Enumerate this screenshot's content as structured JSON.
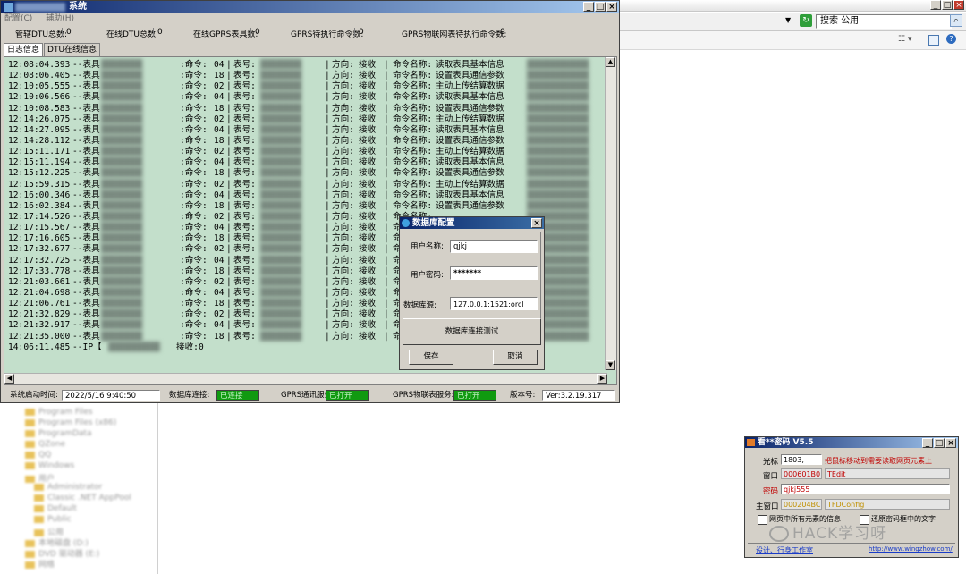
{
  "explorer": {
    "search_text": "搜索 公用",
    "tree_items": [
      "Program Files",
      "Program Files (x86)",
      "ProgramData",
      "QZone",
      "QQ",
      "Windows",
      "用户",
      "Administrator",
      "Classic .NET AppPool",
      "Default",
      "Public",
      "公用",
      "本地磁盘 (D:)",
      "DVD 驱动器 (E:)",
      "网络"
    ]
  },
  "main_window": {
    "title": "系统",
    "menu": [
      "配置(C)",
      "辅助(H)"
    ],
    "stats": [
      {
        "label": "管辖DTU总数:",
        "value": "0"
      },
      {
        "label": "在线DTU总数:",
        "value": "0"
      },
      {
        "label": "在线GPRS表具数:",
        "value": "0"
      },
      {
        "label": "GPRS待执行命令数:",
        "value": "0"
      },
      {
        "label": "GPRS物联网表待执行命令数:",
        "value": "0"
      }
    ],
    "tabs": [
      "日志信息",
      "DTU在线信息"
    ],
    "log_lines": [
      {
        "time": "12:08:04.393",
        "cmd": "04",
        "dir": "接收",
        "name": "读取表具基本信息"
      },
      {
        "time": "12:08:06.405",
        "cmd": "18",
        "dir": "接收",
        "name": "设置表具通信参数"
      },
      {
        "time": "12:10:05.555",
        "cmd": "02",
        "dir": "接收",
        "name": "主动上传结算数据"
      },
      {
        "time": "12:10:06.566",
        "cmd": "04",
        "dir": "接收",
        "name": "读取表具基本信息"
      },
      {
        "time": "12:10:08.583",
        "cmd": "18",
        "dir": "接收",
        "name": "设置表具通信参数"
      },
      {
        "time": "12:14:26.075",
        "cmd": "02",
        "dir": "接收",
        "name": "主动上传结算数据"
      },
      {
        "time": "12:14:27.095",
        "cmd": "04",
        "dir": "接收",
        "name": "读取表具基本信息"
      },
      {
        "time": "12:14:28.112",
        "cmd": "18",
        "dir": "接收",
        "name": "设置表具通信参数"
      },
      {
        "time": "12:15:11.171",
        "cmd": "02",
        "dir": "接收",
        "name": "主动上传结算数据"
      },
      {
        "time": "12:15:11.194",
        "cmd": "04",
        "dir": "接收",
        "name": "读取表具基本信息"
      },
      {
        "time": "12:15:12.225",
        "cmd": "18",
        "dir": "接收",
        "name": "设置表具通信参数"
      },
      {
        "time": "12:15:59.315",
        "cmd": "02",
        "dir": "接收",
        "name": "主动上传结算数据"
      },
      {
        "time": "12:16:00.346",
        "cmd": "04",
        "dir": "接收",
        "name": "读取表具基本信息"
      },
      {
        "time": "12:16:02.384",
        "cmd": "18",
        "dir": "接收",
        "name": "设置表具通信参数"
      },
      {
        "time": "12:17:14.526",
        "cmd": "02",
        "dir": "接收",
        "name": ""
      },
      {
        "time": "12:17:15.567",
        "cmd": "04",
        "dir": "接收",
        "name": ""
      },
      {
        "time": "12:17:16.605",
        "cmd": "18",
        "dir": "接收",
        "name": ""
      },
      {
        "time": "12:17:32.677",
        "cmd": "02",
        "dir": "接收",
        "name": ""
      },
      {
        "time": "12:17:32.725",
        "cmd": "04",
        "dir": "接收",
        "name": ""
      },
      {
        "time": "12:17:33.778",
        "cmd": "18",
        "dir": "接收",
        "name": ""
      },
      {
        "time": "12:21:03.661",
        "cmd": "02",
        "dir": "接收",
        "name": ""
      },
      {
        "time": "12:21:04.698",
        "cmd": "04",
        "dir": "接收",
        "name": ""
      },
      {
        "time": "12:21:06.761",
        "cmd": "18",
        "dir": "接收",
        "name": ""
      },
      {
        "time": "12:21:32.829",
        "cmd": "02",
        "dir": "接收",
        "name": ""
      },
      {
        "time": "12:21:32.917",
        "cmd": "04",
        "dir": "接收",
        "name": ""
      },
      {
        "time": "12:21:35.000",
        "cmd": "18",
        "dir": "接收",
        "name": ""
      }
    ],
    "log_labels": {
      "meter_prefix": "--表具",
      "cmd_label": ":命令:",
      "meter_no": "表号:",
      "dir_label": "方向:",
      "name_label": "命令名称:"
    },
    "last_line": {
      "time": "14:06:11.485",
      "text": "--IP【",
      "tail": "接收:0"
    },
    "status": {
      "start_label": "系统启动时间:",
      "start_value": "2022/5/16 9:40:50",
      "db_label": "数据库连接:",
      "db_value": "已连接",
      "gprs_label": "GPRS通讯服务:",
      "gprs_value": "已打开",
      "iot_label": "GPRS物联表服务:",
      "iot_value": "已打开",
      "ver_label": "版本号:",
      "ver_value": "Ver:3.2.19.317"
    },
    "colors": {
      "log_bg": "#c3dfcb",
      "status_green": "#109a10",
      "titlebar": "#0a246a"
    }
  },
  "db_dialog": {
    "title": "数据库配置",
    "user_label": "用户名称:",
    "user_value": "qjkj",
    "pwd_label": "用户密码:",
    "pwd_value": "*******",
    "db_label": "数据库源:",
    "db_value": "127.0.0.1:1521:orcl",
    "test_button": "数据库连接测试",
    "save_button": "保存",
    "cancel_button": "取消"
  },
  "tool_window": {
    "title": "看**密码 V5.5",
    "cursor_label": "光标",
    "cursor_value": "1803, 1469",
    "cursor_hint": "把鼠标移动到需要读取网页元素上",
    "window_label": "窗口",
    "window_handle": "000601B0",
    "window_class": "TEdit",
    "pwd_label": "密码",
    "pwd_value": "qjkj555",
    "main_label": "主窗口",
    "main_handle": "000204BC",
    "main_class": "TFDConfig",
    "check1": "网页中所有元素的信息",
    "check2": "还原密码框中的文字",
    "link_design": "设计、行身工作室",
    "link_url": "http://www.wingzhow.com/"
  },
  "watermark": "HACK学习呀"
}
